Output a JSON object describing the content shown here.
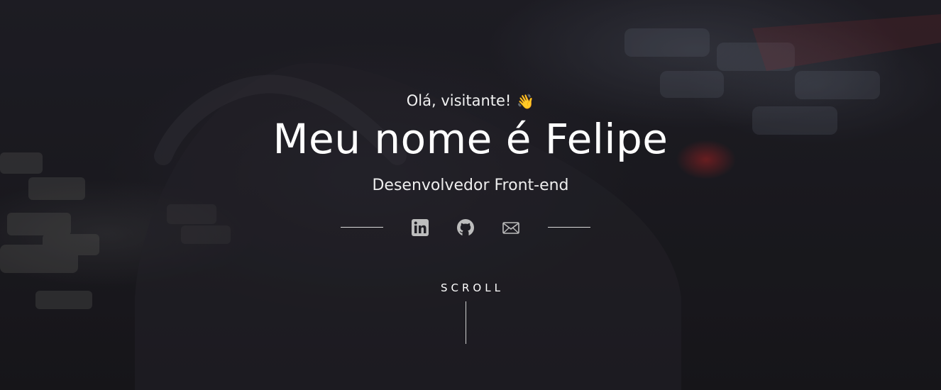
{
  "hero": {
    "greeting": "Olá, visitante!",
    "wave_emoji": "👋",
    "title": "Meu nome é Felipe",
    "subtitle": "Desenvolvedor Front-end",
    "scroll_label": "SCROLL"
  },
  "social": {
    "links": [
      {
        "name": "linkedin-icon"
      },
      {
        "name": "github-icon"
      },
      {
        "name": "mail-icon"
      }
    ],
    "icon_color": "#bdbdbd"
  },
  "colors": {
    "background": "#1b1a1f",
    "text": "#ffffff",
    "accent_glow": "#dc2828"
  }
}
